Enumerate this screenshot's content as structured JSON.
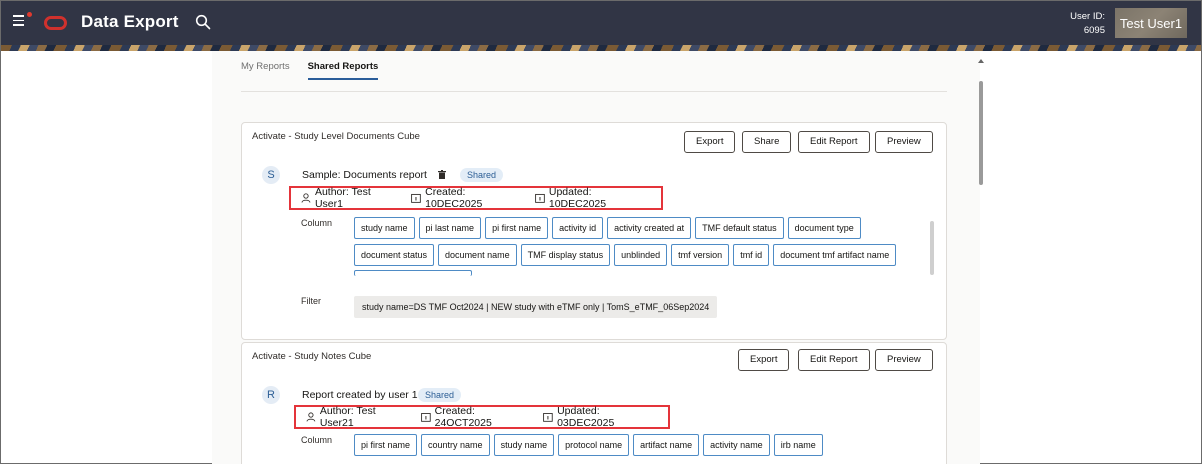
{
  "header": {
    "app_title": "Data Export",
    "user_id_label": "User ID:",
    "user_id_value": "6095",
    "user_name": "Test User1",
    "colors": {
      "bar": "#313545",
      "logo": "#d0312d"
    }
  },
  "tabs": [
    {
      "label": "My Reports",
      "active": false
    },
    {
      "label": "Shared Reports",
      "active": true
    }
  ],
  "cards": [
    {
      "title": "Activate - Study Level Documents Cube",
      "buttons": [
        "Export",
        "Share",
        "Edit Report",
        "Preview"
      ],
      "avatar_letter": "S",
      "report_name": "Sample: Documents report",
      "badge": "Shared",
      "author": "Author: Test User1",
      "created": "Created: 10DEC2025",
      "updated": "Updated: 10DEC2025",
      "column_label": "Column",
      "columns": [
        "study name",
        "pi last name",
        "pi first name",
        "activity id",
        "activity created at",
        "TMF default status",
        "document type",
        "document status",
        "document name",
        "TMF display status",
        "unblinded",
        "tmf version",
        "tmf id",
        "document tmf artifact name"
      ],
      "filter_label": "Filter",
      "filter_value": "study name=DS TMF Oct2024 | NEW study with eTMF only | TomS_eTMF_06Sep2024"
    },
    {
      "title": "Activate - Study Notes Cube",
      "buttons": [
        "Export",
        "Edit Report",
        "Preview"
      ],
      "avatar_letter": "R",
      "report_name": "Report created by user 1",
      "badge": "Shared",
      "author": "Author: Test User21",
      "created": "Created: 24OCT2025",
      "updated": "Updated: 03DEC2025",
      "column_label": "Column",
      "columns": [
        "pi first name",
        "country name",
        "study name",
        "protocol name",
        "artifact name",
        "activity name",
        "irb name"
      ]
    }
  ]
}
